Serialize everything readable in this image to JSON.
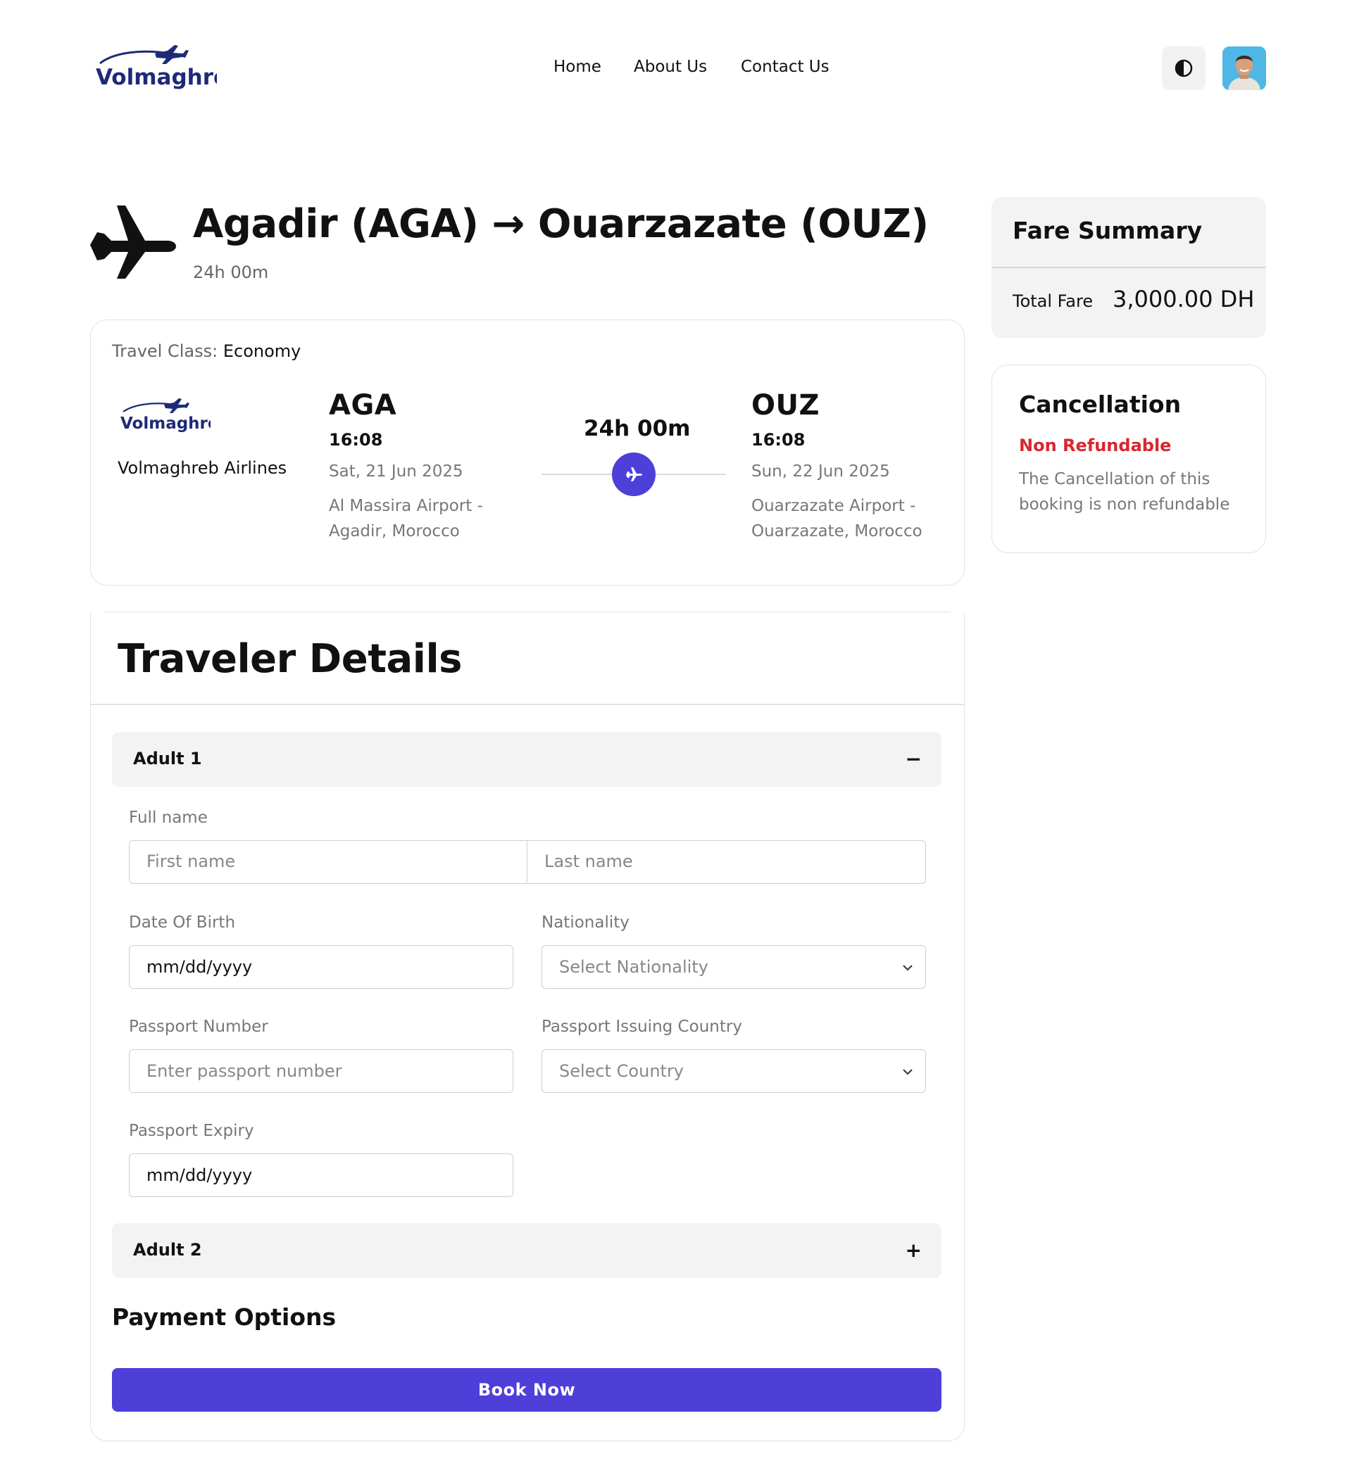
{
  "brand": {
    "name": "Volmaghreb",
    "accent": "#4f3fd9",
    "logo_color": "#1e2a78"
  },
  "nav": {
    "home": "Home",
    "about": "About Us",
    "contact": "Contact Us"
  },
  "route": {
    "title": "Agadir (AGA) → Ouarzazate (OUZ)",
    "duration": "24h 00m"
  },
  "flight": {
    "travel_class_label": "Travel Class:",
    "travel_class_value": "Economy",
    "airline": "Volmaghreb Airlines",
    "duration": "24h 00m",
    "departure": {
      "code": "AGA",
      "time": "16:08",
      "date": "Sat, 21 Jun 2025",
      "airport": "Al Massira Airport - Agadir, Morocco"
    },
    "arrival": {
      "code": "OUZ",
      "time": "16:08",
      "date": "Sun, 22 Jun 2025",
      "airport": "Ouarzazate Airport - Ouarzazate, Morocco"
    }
  },
  "traveler": {
    "title": "Traveler Details",
    "adult1": {
      "label": "Adult 1",
      "toggle": "−"
    },
    "adult2": {
      "label": "Adult 2",
      "toggle": "+"
    },
    "full_name_label": "Full name",
    "first_name_placeholder": "First name",
    "last_name_placeholder": "Last name",
    "dob_label": "Date Of Birth",
    "dob_value": "mm/dd/yyyy",
    "nationality_label": "Nationality",
    "nationality_placeholder": "Select Nationality",
    "passport_number_label": "Passport Number",
    "passport_number_placeholder": "Enter passport number",
    "passport_country_label": "Passport Issuing Country",
    "passport_country_placeholder": "Select Country",
    "passport_expiry_label": "Passport Expiry",
    "passport_expiry_value": "mm/dd/yyyy"
  },
  "payment": {
    "title": "Payment Options",
    "book_label": "Book Now"
  },
  "fare": {
    "title": "Fare Summary",
    "total_label": "Total Fare",
    "total_value": "3,000.00 DH"
  },
  "cancellation": {
    "title": "Cancellation",
    "status": "Non Refundable",
    "status_color": "#d9262f",
    "description": "The Cancellation of this booking is non refundable"
  },
  "icons": [
    "plane-logo-icon",
    "theme-toggle-icon",
    "user-avatar",
    "airplane-icon",
    "chevron-down-icon"
  ]
}
